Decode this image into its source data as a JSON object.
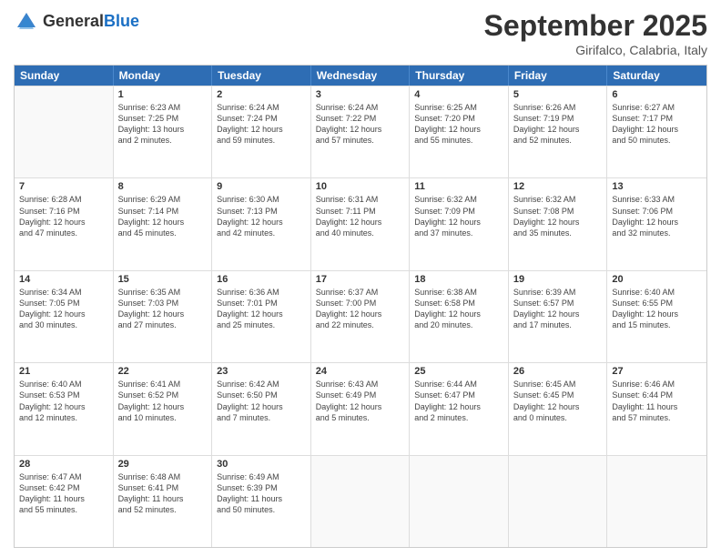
{
  "header": {
    "logo": {
      "general": "General",
      "blue": "Blue"
    },
    "title": "September 2025",
    "subtitle": "Girifalco, Calabria, Italy"
  },
  "weekdays": [
    "Sunday",
    "Monday",
    "Tuesday",
    "Wednesday",
    "Thursday",
    "Friday",
    "Saturday"
  ],
  "weeks": [
    [
      {
        "day": "",
        "info": ""
      },
      {
        "day": "1",
        "info": "Sunrise: 6:23 AM\nSunset: 7:25 PM\nDaylight: 13 hours\nand 2 minutes."
      },
      {
        "day": "2",
        "info": "Sunrise: 6:24 AM\nSunset: 7:24 PM\nDaylight: 12 hours\nand 59 minutes."
      },
      {
        "day": "3",
        "info": "Sunrise: 6:24 AM\nSunset: 7:22 PM\nDaylight: 12 hours\nand 57 minutes."
      },
      {
        "day": "4",
        "info": "Sunrise: 6:25 AM\nSunset: 7:20 PM\nDaylight: 12 hours\nand 55 minutes."
      },
      {
        "day": "5",
        "info": "Sunrise: 6:26 AM\nSunset: 7:19 PM\nDaylight: 12 hours\nand 52 minutes."
      },
      {
        "day": "6",
        "info": "Sunrise: 6:27 AM\nSunset: 7:17 PM\nDaylight: 12 hours\nand 50 minutes."
      }
    ],
    [
      {
        "day": "7",
        "info": "Sunrise: 6:28 AM\nSunset: 7:16 PM\nDaylight: 12 hours\nand 47 minutes."
      },
      {
        "day": "8",
        "info": "Sunrise: 6:29 AM\nSunset: 7:14 PM\nDaylight: 12 hours\nand 45 minutes."
      },
      {
        "day": "9",
        "info": "Sunrise: 6:30 AM\nSunset: 7:13 PM\nDaylight: 12 hours\nand 42 minutes."
      },
      {
        "day": "10",
        "info": "Sunrise: 6:31 AM\nSunset: 7:11 PM\nDaylight: 12 hours\nand 40 minutes."
      },
      {
        "day": "11",
        "info": "Sunrise: 6:32 AM\nSunset: 7:09 PM\nDaylight: 12 hours\nand 37 minutes."
      },
      {
        "day": "12",
        "info": "Sunrise: 6:32 AM\nSunset: 7:08 PM\nDaylight: 12 hours\nand 35 minutes."
      },
      {
        "day": "13",
        "info": "Sunrise: 6:33 AM\nSunset: 7:06 PM\nDaylight: 12 hours\nand 32 minutes."
      }
    ],
    [
      {
        "day": "14",
        "info": "Sunrise: 6:34 AM\nSunset: 7:05 PM\nDaylight: 12 hours\nand 30 minutes."
      },
      {
        "day": "15",
        "info": "Sunrise: 6:35 AM\nSunset: 7:03 PM\nDaylight: 12 hours\nand 27 minutes."
      },
      {
        "day": "16",
        "info": "Sunrise: 6:36 AM\nSunset: 7:01 PM\nDaylight: 12 hours\nand 25 minutes."
      },
      {
        "day": "17",
        "info": "Sunrise: 6:37 AM\nSunset: 7:00 PM\nDaylight: 12 hours\nand 22 minutes."
      },
      {
        "day": "18",
        "info": "Sunrise: 6:38 AM\nSunset: 6:58 PM\nDaylight: 12 hours\nand 20 minutes."
      },
      {
        "day": "19",
        "info": "Sunrise: 6:39 AM\nSunset: 6:57 PM\nDaylight: 12 hours\nand 17 minutes."
      },
      {
        "day": "20",
        "info": "Sunrise: 6:40 AM\nSunset: 6:55 PM\nDaylight: 12 hours\nand 15 minutes."
      }
    ],
    [
      {
        "day": "21",
        "info": "Sunrise: 6:40 AM\nSunset: 6:53 PM\nDaylight: 12 hours\nand 12 minutes."
      },
      {
        "day": "22",
        "info": "Sunrise: 6:41 AM\nSunset: 6:52 PM\nDaylight: 12 hours\nand 10 minutes."
      },
      {
        "day": "23",
        "info": "Sunrise: 6:42 AM\nSunset: 6:50 PM\nDaylight: 12 hours\nand 7 minutes."
      },
      {
        "day": "24",
        "info": "Sunrise: 6:43 AM\nSunset: 6:49 PM\nDaylight: 12 hours\nand 5 minutes."
      },
      {
        "day": "25",
        "info": "Sunrise: 6:44 AM\nSunset: 6:47 PM\nDaylight: 12 hours\nand 2 minutes."
      },
      {
        "day": "26",
        "info": "Sunrise: 6:45 AM\nSunset: 6:45 PM\nDaylight: 12 hours\nand 0 minutes."
      },
      {
        "day": "27",
        "info": "Sunrise: 6:46 AM\nSunset: 6:44 PM\nDaylight: 11 hours\nand 57 minutes."
      }
    ],
    [
      {
        "day": "28",
        "info": "Sunrise: 6:47 AM\nSunset: 6:42 PM\nDaylight: 11 hours\nand 55 minutes."
      },
      {
        "day": "29",
        "info": "Sunrise: 6:48 AM\nSunset: 6:41 PM\nDaylight: 11 hours\nand 52 minutes."
      },
      {
        "day": "30",
        "info": "Sunrise: 6:49 AM\nSunset: 6:39 PM\nDaylight: 11 hours\nand 50 minutes."
      },
      {
        "day": "",
        "info": ""
      },
      {
        "day": "",
        "info": ""
      },
      {
        "day": "",
        "info": ""
      },
      {
        "day": "",
        "info": ""
      }
    ]
  ]
}
